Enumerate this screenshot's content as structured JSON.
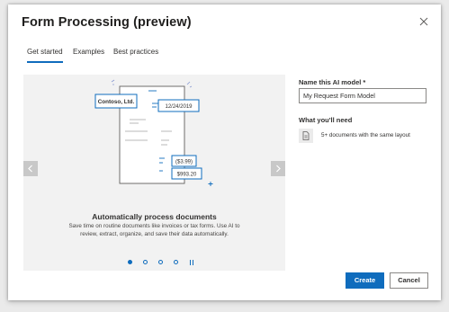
{
  "dialog": {
    "title": "Form Processing (preview)"
  },
  "tabs": [
    {
      "label": "Get started",
      "active": true
    },
    {
      "label": "Examples",
      "active": false
    },
    {
      "label": "Best practices",
      "active": false
    }
  ],
  "carousel": {
    "illustration": {
      "vendor_label": "Contoso, Ltd.",
      "date_label": "12/24/2019",
      "amount1_label": "($3.99)",
      "amount2_label": "$993.20"
    },
    "caption": "Automatically process documents",
    "description": "Save time on routine documents like invoices or tax forms. Use AI to review, extract, organize, and save their data automatically.",
    "active_slide": 1,
    "slide_count": 4
  },
  "form": {
    "name_label": "Name this AI model *",
    "name_value": "My Request Form Model",
    "need_label": "What you'll need",
    "requirement_icon": "document-icon",
    "requirement_text": "5+ documents with the same layout"
  },
  "buttons": {
    "create_label": "Create",
    "cancel_label": "Cancel"
  },
  "colors": {
    "accent": "#0f6cbd",
    "carousel_bg": "#f2f2f2"
  }
}
